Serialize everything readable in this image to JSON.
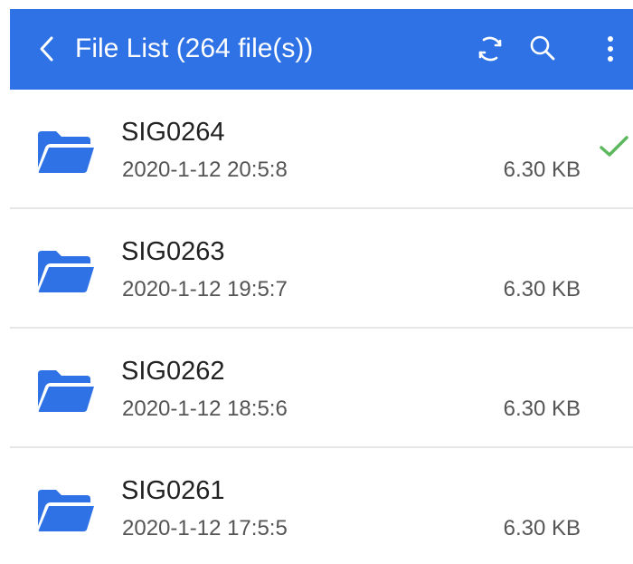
{
  "app_bar": {
    "title": "File List (264 file(s))",
    "background_color": "#2f72e6",
    "back_icon": "chevron-left-icon",
    "actions": [
      {
        "icon": "refresh-icon"
      },
      {
        "icon": "search-icon"
      },
      {
        "icon": "more-vert-icon"
      }
    ]
  },
  "files": [
    {
      "name": "SIG0264",
      "date": "2020-1-12 20:5:8",
      "size": "6.30 KB",
      "icon": "folder-icon",
      "checked": true
    },
    {
      "name": "SIG0263",
      "date": "2020-1-12 19:5:7",
      "size": "6.30 KB",
      "icon": "folder-icon",
      "checked": false
    },
    {
      "name": "SIG0262",
      "date": "2020-1-12 18:5:6",
      "size": "6.30 KB",
      "icon": "folder-icon",
      "checked": false
    },
    {
      "name": "SIG0261",
      "date": "2020-1-12 17:5:5",
      "size": "6.30 KB",
      "icon": "folder-icon",
      "checked": false
    }
  ],
  "colors": {
    "folder": "#2f72e6",
    "check": "#5cb85c",
    "divider": "#e6e6e6"
  }
}
